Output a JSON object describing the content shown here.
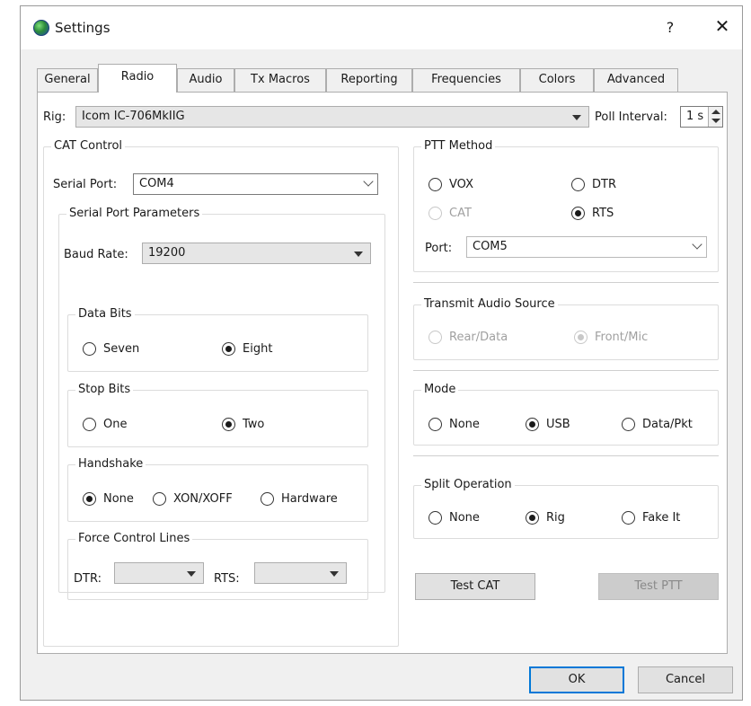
{
  "window": {
    "title": "Settings",
    "help_label": "?",
    "close_label": "✕"
  },
  "tabs": [
    {
      "label": "General"
    },
    {
      "label": "Radio",
      "active": true
    },
    {
      "label": "Audio"
    },
    {
      "label": "Tx Macros"
    },
    {
      "label": "Reporting"
    },
    {
      "label": "Frequencies"
    },
    {
      "label": "Colors"
    },
    {
      "label": "Advanced"
    }
  ],
  "rig": {
    "label": "Rig:",
    "value": "Icom IC-706MkIIG",
    "poll_label": "Poll Interval:",
    "poll_value": "1 s"
  },
  "cat": {
    "title": "CAT Control",
    "serial_port_label": "Serial Port:",
    "serial_port_value": "COM4",
    "params_title": "Serial Port Parameters",
    "baud_label": "Baud Rate:",
    "baud_value": "19200",
    "data_bits": {
      "title": "Data Bits",
      "options": [
        "Seven",
        "Eight"
      ],
      "selected": "Eight"
    },
    "stop_bits": {
      "title": "Stop Bits",
      "options": [
        "One",
        "Two"
      ],
      "selected": "Two"
    },
    "handshake": {
      "title": "Handshake",
      "options": [
        "None",
        "XON/XOFF",
        "Hardware"
      ],
      "selected": "None"
    },
    "force": {
      "title": "Force Control Lines",
      "dtr_label": "DTR:",
      "rts_label": "RTS:"
    }
  },
  "ptt": {
    "title": "PTT Method",
    "options": [
      "VOX",
      "DTR",
      "CAT",
      "RTS"
    ],
    "selected": "RTS",
    "port_label": "Port:",
    "port_value": "COM5"
  },
  "tx_audio": {
    "title": "Transmit Audio Source",
    "options": [
      "Rear/Data",
      "Front/Mic"
    ],
    "selected": "Front/Mic"
  },
  "mode": {
    "title": "Mode",
    "options": [
      "None",
      "USB",
      "Data/Pkt"
    ],
    "selected": "USB"
  },
  "split": {
    "title": "Split Operation",
    "options": [
      "None",
      "Rig",
      "Fake It"
    ],
    "selected": "Rig"
  },
  "buttons": {
    "test_cat": "Test CAT",
    "test_ptt": "Test PTT",
    "ok": "OK",
    "cancel": "Cancel"
  }
}
